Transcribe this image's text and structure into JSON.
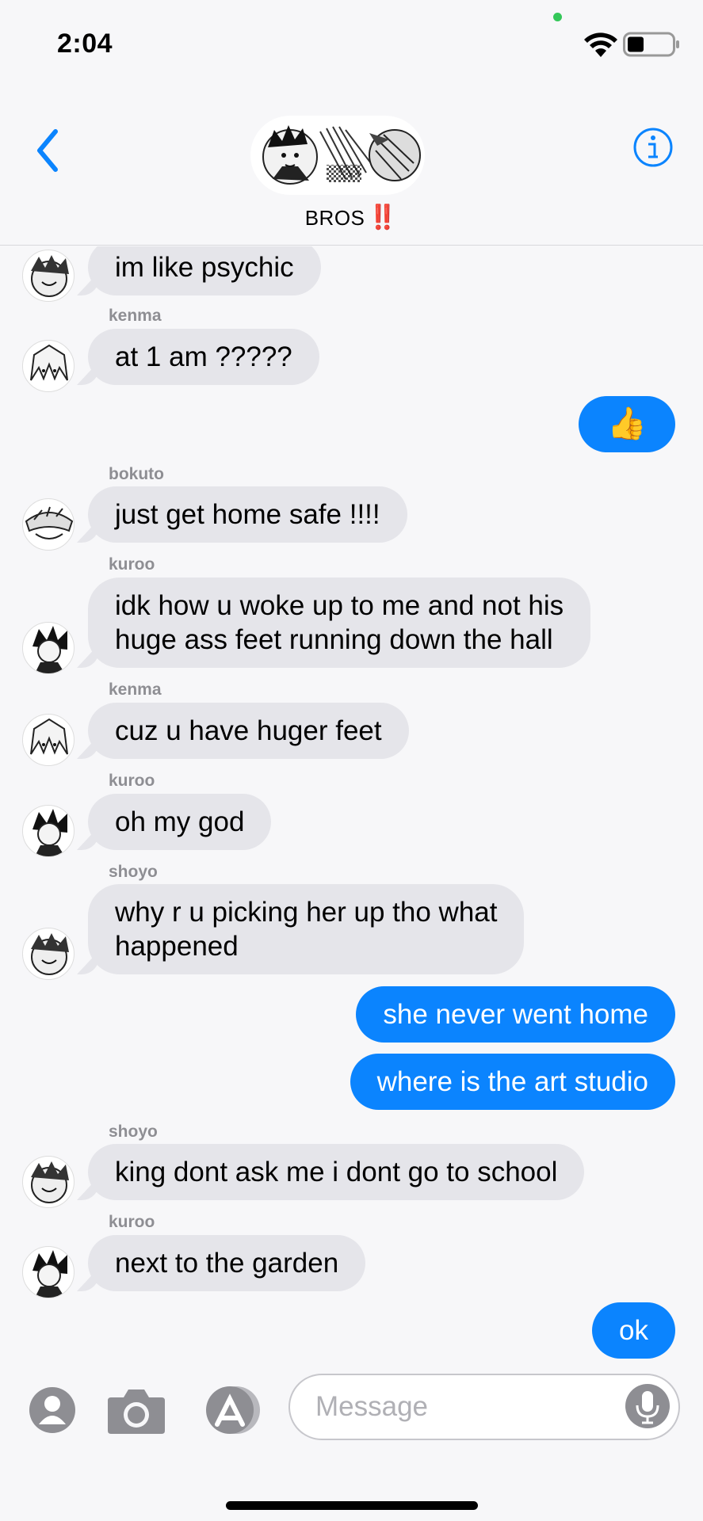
{
  "status_bar": {
    "time": "2:04"
  },
  "header": {
    "group_name": "BROS",
    "group_emoji": "‼️"
  },
  "input": {
    "placeholder": "Message"
  },
  "messages": [
    {
      "dir": "in",
      "sender": "",
      "text": "im like psychic"
    },
    {
      "dir": "in",
      "sender": "kenma",
      "text": "at 1 am ?????"
    },
    {
      "dir": "out",
      "text": "👍"
    },
    {
      "dir": "in",
      "sender": "bokuto",
      "text": "just get home safe !!!!"
    },
    {
      "dir": "in",
      "sender": "kuroo",
      "line1": "idk how u woke up to me and not his",
      "line2": "huge ass feet running down the hall"
    },
    {
      "dir": "in",
      "sender": "kenma",
      "text": "cuz u have huger feet"
    },
    {
      "dir": "in",
      "sender": "kuroo",
      "text": "oh my god"
    },
    {
      "dir": "in",
      "sender": "shoyo",
      "line1": "why r u picking her up tho what",
      "line2": "happened"
    },
    {
      "dir": "out",
      "text": "she never went home"
    },
    {
      "dir": "out",
      "text": "where is the art studio"
    },
    {
      "dir": "in",
      "sender": "shoyo",
      "text": "king dont ask me i dont go to school"
    },
    {
      "dir": "in",
      "sender": "kuroo",
      "text": "next to the garden"
    },
    {
      "dir": "out",
      "text": "ok"
    }
  ],
  "colors": {
    "accent": "#0b84fe",
    "incoming_bubble": "#e5e5ea",
    "background": "#f7f7f9"
  },
  "icons": [
    "back-chevron-icon",
    "info-icon",
    "wifi-icon",
    "battery-icon",
    "contacts-icon",
    "camera-icon",
    "app-store-icon",
    "microphone-icon"
  ]
}
